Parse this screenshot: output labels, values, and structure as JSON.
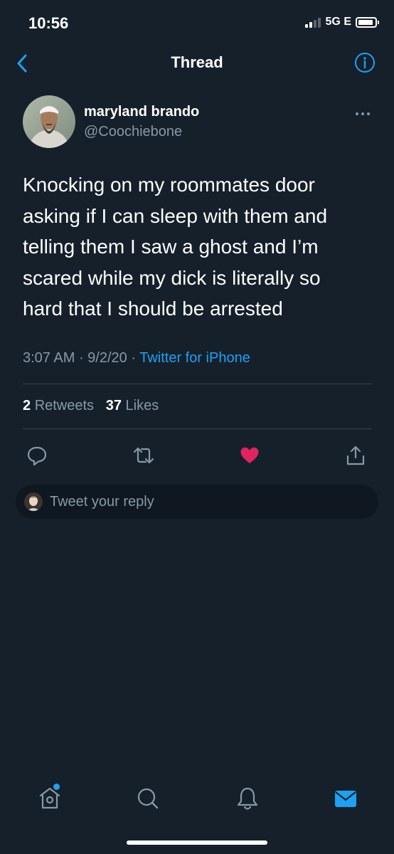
{
  "status_bar": {
    "time": "10:56",
    "network": "5G E"
  },
  "header": {
    "title": "Thread"
  },
  "tweet": {
    "display_name": "maryland brando",
    "handle": "@Coochiebone",
    "text": "Knocking on my roommates door asking if I can sleep with them and telling them I saw a ghost and I’m scared while my dick is literally so hard that I should be arrested",
    "time": "3:07 AM",
    "date": "9/2/20",
    "source": "Twitter for iPhone",
    "retweet_count": "2",
    "retweet_label": "Retweets",
    "like_count": "37",
    "like_label": "Likes",
    "liked": true
  },
  "reply": {
    "placeholder": "Tweet your reply"
  },
  "colors": {
    "background": "#15202b",
    "accent": "#1da1f2",
    "like": "#e0245e",
    "secondary_text": "#8899a6",
    "divider": "#38444d"
  },
  "icons": {
    "back": "chevron-left-icon",
    "info": "info-icon",
    "more": "more-horizontal-icon",
    "reply": "reply-icon",
    "retweet": "retweet-icon",
    "like": "heart-icon",
    "share": "share-icon",
    "home": "home-icon",
    "search": "search-icon",
    "notifications": "bell-icon",
    "messages": "mail-icon"
  },
  "tabs": [
    {
      "name": "home",
      "active": false,
      "has_badge": true
    },
    {
      "name": "search",
      "active": false
    },
    {
      "name": "notifications",
      "active": false
    },
    {
      "name": "messages",
      "active": true
    }
  ]
}
